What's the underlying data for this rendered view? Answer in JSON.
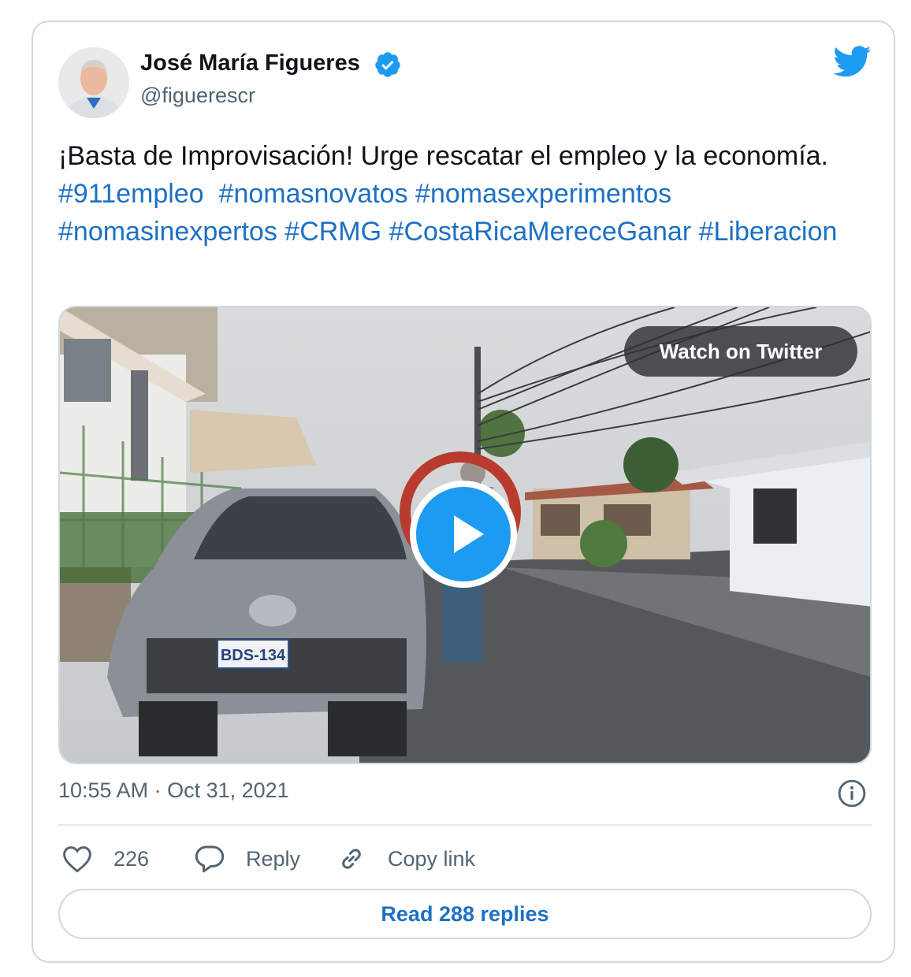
{
  "tweet": {
    "author_name": "José María Figueres",
    "handle": "@figuerescr",
    "text_plain": "¡Basta de Improvisación! Urge rescatar el empleo y la economía.",
    "hashtags": [
      "#911empleo",
      "#nomasnovatos",
      "#nomasexperimentos",
      "#nomasinexpertos",
      "#CRMG",
      "#CostaRicaMereceGanar",
      "#Liberacion"
    ],
    "timestamp": "10:55 AM · Oct 31, 2021"
  },
  "media": {
    "watch_label": "Watch on Twitter",
    "license_plate": "BDS-134"
  },
  "actions": {
    "like_count": "226",
    "reply_label": "Reply",
    "copy_link_label": "Copy link",
    "read_replies_label": "Read 288 replies"
  },
  "colors": {
    "brand": "#1d9bf0",
    "link": "#1d70c4",
    "text": "#0f1419",
    "muted": "#536471",
    "border": "#cfd9de"
  },
  "icons": [
    "verified-badge-icon",
    "twitter-bird-icon",
    "play-icon",
    "info-icon",
    "heart-icon",
    "reply-icon",
    "link-icon"
  ]
}
